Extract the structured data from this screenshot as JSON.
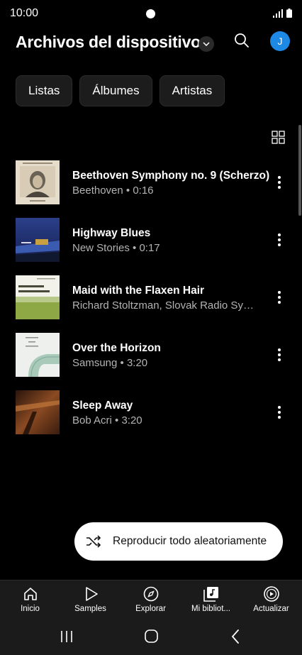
{
  "status_bar": {
    "time": "10:00"
  },
  "header": {
    "title": "Archivos del dispositivo",
    "avatar_initial": "J"
  },
  "chips": [
    {
      "label": "Listas"
    },
    {
      "label": "Álbumes"
    },
    {
      "label": "Artistas"
    }
  ],
  "songs": [
    {
      "title": "Beethoven Symphony no. 9 (Scherzo)",
      "subtitle": "Beethoven • 0:16",
      "cover": "beethoven-portrait"
    },
    {
      "title": "Highway Blues",
      "subtitle": "New Stories • 0:17",
      "cover": "blue-night-highway"
    },
    {
      "title": "Maid with the Flaxen Hair",
      "subtitle": "Richard Stoltzman, Slovak Radio Symphony Orchestra",
      "cover": "richard-stoltzman"
    },
    {
      "title": "Over the Horizon",
      "subtitle": "Samsung • 3:20",
      "cover": "over-the-horizon"
    },
    {
      "title": "Sleep Away",
      "subtitle": "Bob Acri • 3:20",
      "cover": "sleep-away-piano"
    }
  ],
  "shuffle_button": {
    "label": "Reproducir todo aleatoriamente"
  },
  "bottom_nav": [
    {
      "label": "Inicio",
      "icon": "home-icon"
    },
    {
      "label": "Samples",
      "icon": "play-outline-icon"
    },
    {
      "label": "Explorar",
      "icon": "compass-icon"
    },
    {
      "label": "Mi bibliot...",
      "icon": "library-icon"
    },
    {
      "label": "Actualizar",
      "icon": "play-circle-icon"
    }
  ],
  "colors": {
    "background": "#000000",
    "accent": "#1e88e5",
    "secondary_text": "#b3b3b3",
    "nav_background": "#1b1b1b"
  }
}
